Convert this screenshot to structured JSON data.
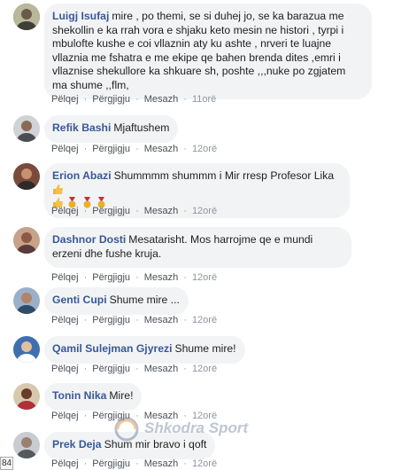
{
  "comments": [
    {
      "author": "Luigj Isufaj",
      "text": "mire , po themi, se si duhej jo, se ka barazua me shekollin e ka rrah vora e shjaku keto mesin ne histori , tyrpi i mbulofte kushe e coi vllaznin aty ku ashte , nrveri te luajne vllaznia me fshatra e me ekipe qe bahen brenda dites ,emri i vllaznise shekullore ka shkuare sh, poshte ,,,nuke po zgjatem ma shume ,,flm,",
      "actions": {
        "like": "Pëlqej",
        "reply": "Përgjigju",
        "message": "Mesazh",
        "time": "11orë"
      },
      "avatar_color": "#6b6a4e"
    },
    {
      "author": "Refik Bashi",
      "text": "Mjaftushem",
      "actions": {
        "like": "Pëlqej",
        "reply": "Përgjigju",
        "message": "Mesazh",
        "time": "12orë"
      },
      "avatar_color": "#8a8f94"
    },
    {
      "author": "Erion Abazi",
      "text": "Shummmm shummm i Mir rresp Profesor Lika",
      "actions": {
        "like": "Pëlqej",
        "reply": "Përgjigju",
        "message": "Mesazh",
        "time": "12orë"
      },
      "avatar_color": "#7a4a3a"
    },
    {
      "author": "Dashnor Dosti",
      "text": "Mesatarisht. Mos harrojme qe e mundi erzeni dhe fushe kruja.",
      "actions": {
        "like": "Pëlqej",
        "reply": "Përgjigju",
        "message": "Mesazh",
        "time": "12orë"
      },
      "avatar_color": "#9a6a5a"
    },
    {
      "author": "Genti Cupi",
      "text": "Shume mire ...",
      "actions": {
        "like": "Pëlqej",
        "reply": "Përgjigju",
        "message": "Mesazh",
        "time": "12orë"
      },
      "avatar_color": "#5f7a9a"
    },
    {
      "author": "Qamil Sulejman Gjyrezi",
      "text": "Shume mire!",
      "actions": {
        "like": "Pëlqej",
        "reply": "Përgjigju",
        "message": "Mesazh",
        "time": "12orë"
      },
      "avatar_color": "#3f6fb0"
    },
    {
      "author": "Tonin Nika",
      "text": "Mire!",
      "actions": {
        "like": "Pëlqej",
        "reply": "Përgjigju",
        "message": "Mesazh",
        "time": "12orë"
      },
      "avatar_color": "#b0303a"
    },
    {
      "author": "Prek Deja",
      "text": "Shum mir bravo i qoft",
      "actions": {
        "like": "Pëlqej",
        "reply": "Përgjigju",
        "message": "Mesazh",
        "time": "12orë"
      },
      "avatar_color": "#7c8086"
    }
  ],
  "watermark": "Shkodra Sport",
  "corner_badge": "84",
  "colors": {
    "author": "#385898",
    "bubble": "#f2f3f5",
    "meta": "#90949c"
  }
}
